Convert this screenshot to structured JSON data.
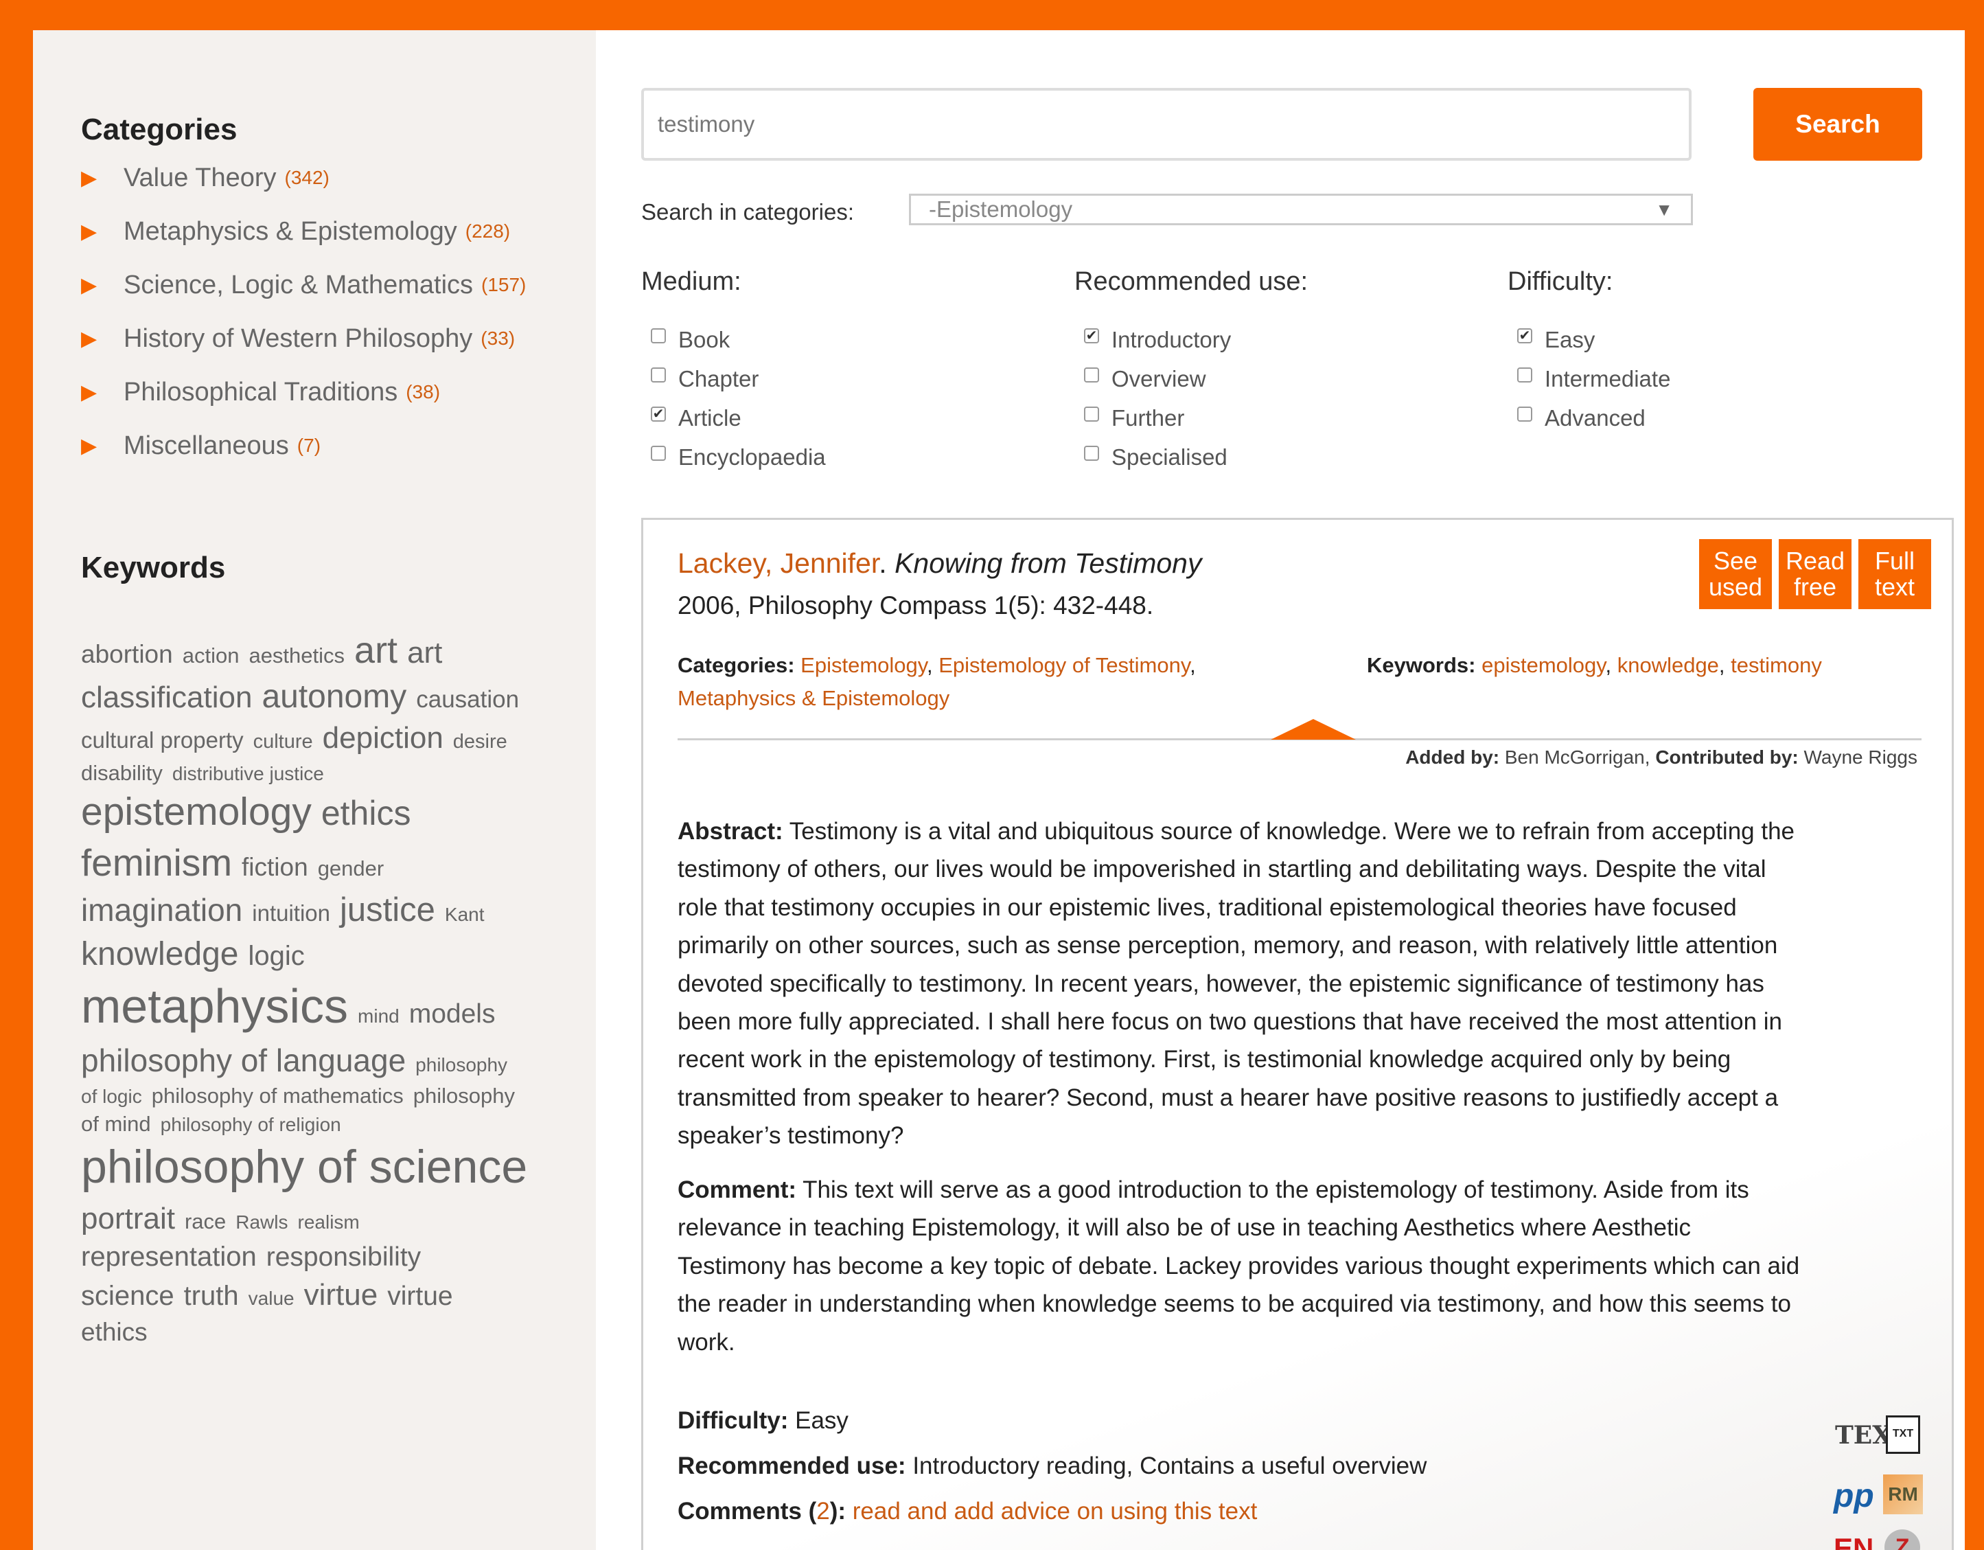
{
  "sidebar": {
    "categories_heading": "Categories",
    "categories": [
      {
        "label": "Value Theory",
        "count": "(342)"
      },
      {
        "label": "Metaphysics & Epistemology",
        "count": "(228)"
      },
      {
        "label": "Science, Logic & Mathematics",
        "count": "(157)"
      },
      {
        "label": "History of Western Philosophy",
        "count": "(33)"
      },
      {
        "label": "Philosophical Traditions",
        "count": "(38)"
      },
      {
        "label": "Miscellaneous",
        "count": "(7)"
      }
    ],
    "keywords_heading": "Keywords",
    "keyword_lines": [
      [
        {
          "t": "abortion",
          "s": 37
        },
        {
          "t": "action",
          "s": 31
        },
        {
          "t": "aesthetics",
          "s": 31
        },
        {
          "t": "art",
          "s": 54
        },
        {
          "t": "art",
          "s": 44
        }
      ],
      [
        {
          "t": "classification",
          "s": 44
        },
        {
          "t": "autonomy",
          "s": 48
        },
        {
          "t": "causation",
          "s": 35
        }
      ],
      [
        {
          "t": "cultural property",
          "s": 33
        },
        {
          "t": "culture",
          "s": 29
        },
        {
          "t": "depiction",
          "s": 44
        },
        {
          "t": "desire",
          "s": 29
        }
      ],
      [
        {
          "t": "disability",
          "s": 31
        },
        {
          "t": "distributive justice",
          "s": 28
        }
      ],
      [
        {
          "t": "epistemology",
          "s": 57
        },
        {
          "t": "ethics",
          "s": 50
        }
      ],
      [
        {
          "t": "feminism",
          "s": 55
        },
        {
          "t": "fiction",
          "s": 37
        },
        {
          "t": "gender",
          "s": 31
        }
      ],
      [
        {
          "t": "imagination",
          "s": 46
        },
        {
          "t": "intuition",
          "s": 33
        },
        {
          "t": "justice",
          "s": 49
        },
        {
          "t": "Kant",
          "s": 28
        }
      ],
      [
        {
          "t": "knowledge",
          "s": 48
        },
        {
          "t": "logic",
          "s": 40
        }
      ],
      [
        {
          "t": "metaphysics",
          "s": 70
        },
        {
          "t": "mind",
          "s": 28
        },
        {
          "t": "models",
          "s": 39
        }
      ],
      [
        {
          "t": "philosophy of language",
          "s": 46
        },
        {
          "t": "philosophy",
          "s": 28
        }
      ],
      [
        {
          "t": "of logic",
          "s": 28
        },
        {
          "t": "philosophy of mathematics",
          "s": 31
        },
        {
          "t": "philosophy",
          "s": 31
        }
      ],
      [
        {
          "t": "of mind",
          "s": 31
        },
        {
          "t": "philosophy of religion",
          "s": 28
        }
      ],
      [
        {
          "t": "philosophy of science",
          "s": 68
        }
      ],
      [
        {
          "t": "portrait",
          "s": 44
        },
        {
          "t": "race",
          "s": 31
        },
        {
          "t": "Rawls",
          "s": 28
        },
        {
          "t": "realism",
          "s": 28
        }
      ],
      [
        {
          "t": "representation",
          "s": 40
        },
        {
          "t": "responsibility",
          "s": 39
        }
      ],
      [
        {
          "t": "science",
          "s": 40
        },
        {
          "t": "truth",
          "s": 40
        },
        {
          "t": "value",
          "s": 28
        },
        {
          "t": "virtue",
          "s": 44
        },
        {
          "t": "virtue",
          "s": 39
        }
      ],
      [
        {
          "t": "ethics",
          "s": 37
        }
      ]
    ]
  },
  "search": {
    "value": "testimony",
    "button_label": "Search",
    "categories_label": "Search in categories:",
    "selected_category": "-Epistemology"
  },
  "filters": {
    "medium": {
      "heading": "Medium:",
      "options": [
        {
          "label": "Book",
          "checked": false
        },
        {
          "label": "Chapter",
          "checked": false
        },
        {
          "label": "Article",
          "checked": true
        },
        {
          "label": "Encyclopaedia",
          "checked": false
        }
      ]
    },
    "recommended": {
      "heading": "Recommended use:",
      "options": [
        {
          "label": "Introductory",
          "checked": true
        },
        {
          "label": "Overview",
          "checked": false
        },
        {
          "label": "Further",
          "checked": false
        },
        {
          "label": "Specialised",
          "checked": false
        }
      ]
    },
    "difficulty": {
      "heading": "Difficulty:",
      "options": [
        {
          "label": "Easy",
          "checked": true
        },
        {
          "label": "Intermediate",
          "checked": false
        },
        {
          "label": "Advanced",
          "checked": false
        }
      ]
    }
  },
  "result": {
    "author": "Lackey, Jennifer",
    "sep": ".",
    "title": "Knowing from Testimony",
    "publication": "2006, Philosophy Compass 1(5): 432-448.",
    "actions": {
      "see_used_1": "See",
      "see_used_2": "used",
      "read_free_1": "Read",
      "read_free_2": "free",
      "full_text_1": "Full",
      "full_text_2": "text"
    },
    "categories_label": "Categories:",
    "categories": [
      "Epistemology",
      "Epistemology of Testimony",
      "Metaphysics & Epistemology"
    ],
    "keywords_label": "Keywords:",
    "keywords": [
      "epistemology",
      "knowledge",
      "testimony"
    ],
    "added_by_label": "Added by:",
    "added_by": "Ben McGorrigan",
    "contributed_by_label": "Contributed by:",
    "contributed_by": "Wayne Riggs",
    "abstract_label": "Abstract:",
    "abstract_lines": [
      "Testimony is a vital and ubiquitous source of knowledge. Were we to refrain from accepting the",
      "testimony of others, our lives would be impoverished in startling and debilitating ways. Despite the vital",
      "role that testimony occupies in our epistemic lives, traditional epistemological theories have focused",
      "primarily on other sources, such as sense perception, memory, and reason, with relatively little attention",
      "devoted specifically to testimony. In recent years, however, the epistemic significance of testimony has",
      "been more fully appreciated. I shall here focus on two questions that have received the most attention in",
      "recent work in the epistemology of testimony. First, is testimonial knowledge acquired only by being",
      "transmitted from speaker to hearer? Second, must a hearer have positive reasons to justifiedly accept a",
      "speaker’s testimony?"
    ],
    "comment_label": "Comment:",
    "comment_lines": [
      "This text will serve as a good introduction to the epistemology of testimony. Aside from its",
      "relevance in teaching Epistemology, it will also be of use in teaching Aesthetics where Aesthetic",
      "Testimony has become a key topic of debate. Lackey provides various thought experiments which can aid",
      "the reader in understanding when knowledge seems to be acquired via testimony, and how this seems to",
      "work."
    ],
    "difficulty_label": "Difficulty:",
    "difficulty": "Easy",
    "recommended_label": "Recommended use:",
    "recommended": "Introductory reading, Contains a useful overview",
    "comments_label": "Comments (",
    "comments_count": "2",
    "comments_close": "):",
    "comments_link": "read and add advice on using this text",
    "share_icons": [
      "twitter-icon",
      "facebook-icon",
      "google-plus-icon",
      "pinterest-icon",
      "email-icon",
      "share-icon"
    ],
    "format_icons": {
      "tex": "TEX",
      "txt": "TXT",
      "pp": "pp",
      "rm": "RM",
      "en": "EN",
      "z": "Z"
    }
  },
  "colors": {
    "brand_orange": "#f76600",
    "link_orange": "#c95a12",
    "sidebar_bg": "#f4f1ee"
  }
}
